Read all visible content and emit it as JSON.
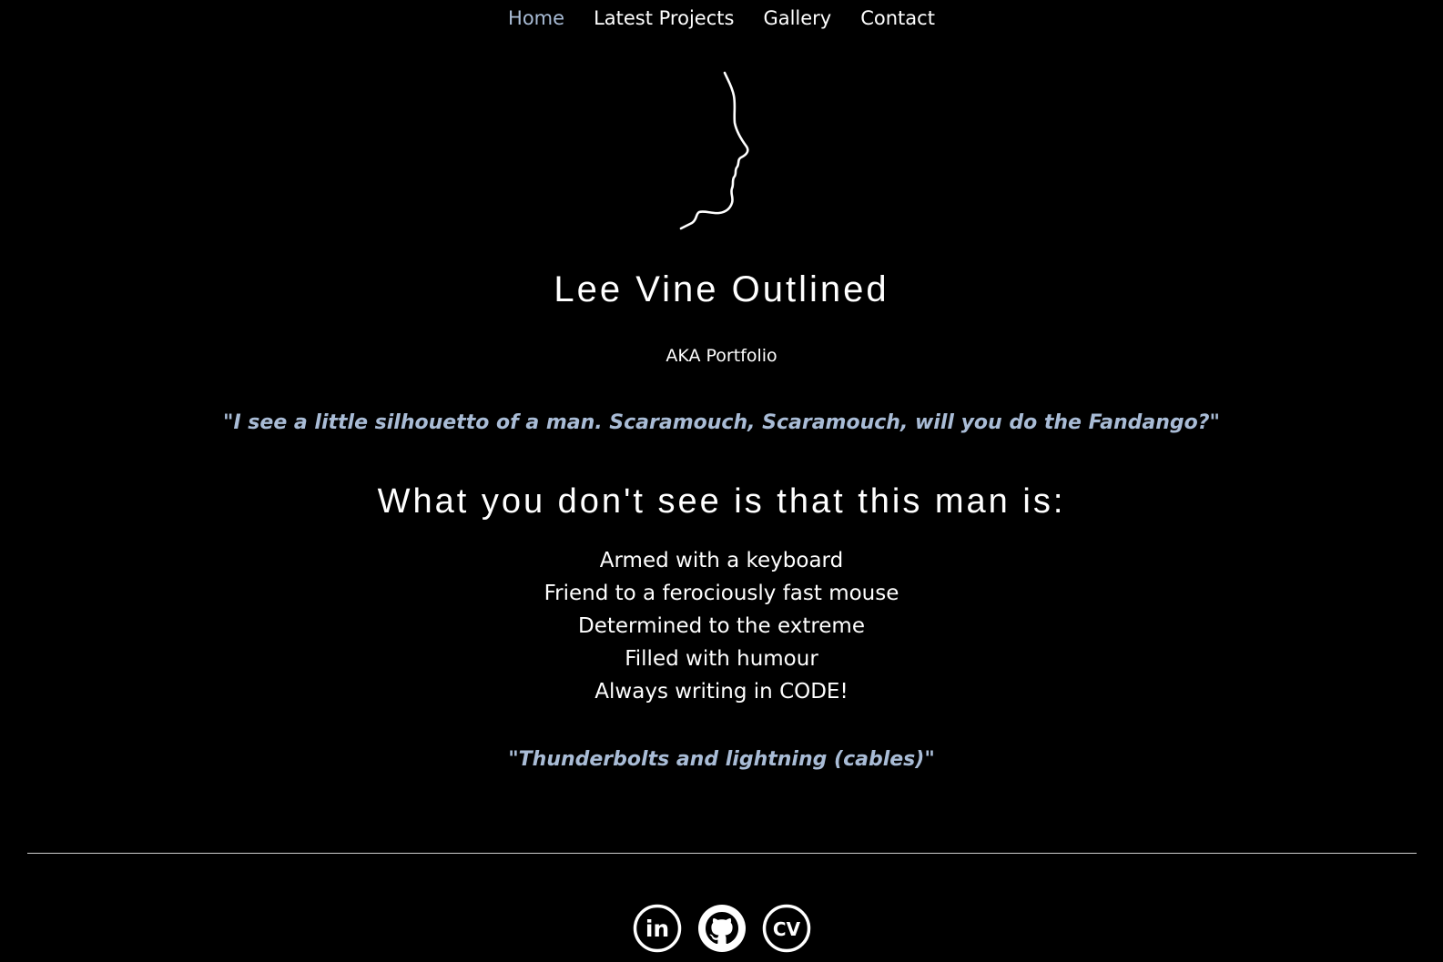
{
  "nav": {
    "items": [
      {
        "label": "Home",
        "active": true
      },
      {
        "label": "Latest Projects",
        "active": false
      },
      {
        "label": "Gallery",
        "active": false
      },
      {
        "label": "Contact",
        "active": false
      }
    ]
  },
  "hero": {
    "logo_icon": "face-silhouette-outline-icon",
    "title": "Lee Vine Outlined",
    "subtitle": "AKA Portfolio"
  },
  "quotes": {
    "first": "\"I see a little silhouetto of a man. Scaramouch, Scaramouch, will you do the Fandango?\"",
    "second": "\"Thunderbolts and lightning (cables)\""
  },
  "about": {
    "heading": "What you don't see is that this man is:",
    "traits": [
      "Armed with a keyboard",
      "Friend to a ferociously fast mouse",
      "Determined to the extreme",
      "Filled with humour",
      "Always writing in CODE!"
    ]
  },
  "footer": {
    "social": [
      {
        "icon": "linkedin-icon",
        "label": "in"
      },
      {
        "icon": "github-icon",
        "label": ""
      },
      {
        "icon": "cv-icon",
        "label": "CV"
      }
    ]
  },
  "colors": {
    "background": "#000000",
    "text": "#ffffff",
    "accent": "#a9bcd6"
  }
}
